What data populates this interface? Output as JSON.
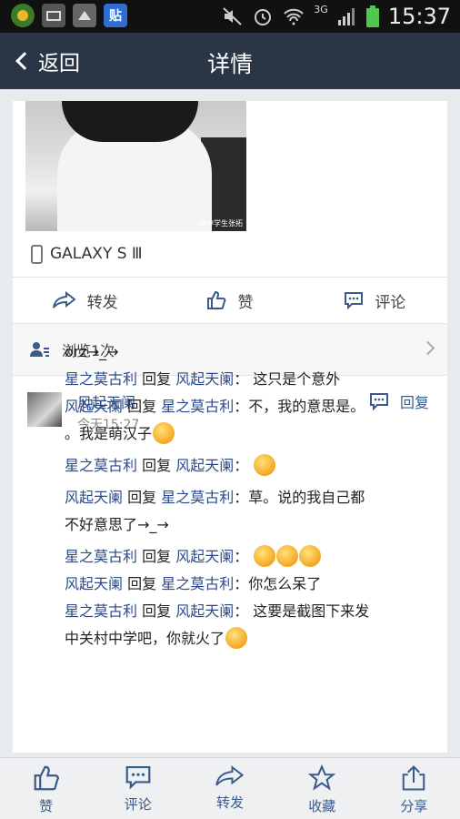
{
  "status_bar": {
    "time": "15:37",
    "network": "3G",
    "left_icons": [
      "app-icon-a",
      "picture-icon",
      "gallery-icon",
      "tieba-icon"
    ],
    "tieba_glyph": "贴",
    "right_icons": [
      "mute-icon",
      "alarm-icon",
      "wifi-icon",
      "signal-icon",
      "battery-icon"
    ]
  },
  "title_bar": {
    "back_label": "返回",
    "title": "详情"
  },
  "post": {
    "photo_watermark": "@中学生张拓",
    "device": "GALAXY S Ⅲ",
    "actions": {
      "repost": "转发",
      "like": "赞",
      "comment": "评论"
    },
    "views": "浏览1次"
  },
  "comment": {
    "author": "风起天阑",
    "time": "今天15:27",
    "reply_label": "回复",
    "lines": {
      "l1": "orz→_→",
      "l2_user": "星之莫古利",
      "l2_verb": " 回复 ",
      "l2_target": "风起天阑",
      "l2_text": "：  这只是个意外",
      "l3_user": "风起天阑",
      "l3_verb": " 回复 ",
      "l3_target": "星之莫古利",
      "l3_text": "：不，我的意思是。",
      "l4_text": "。我是萌汉子",
      "l5_user": "星之莫古利",
      "l5_verb": " 回复 ",
      "l5_target": "风起天阑",
      "l5_text": "：  ",
      "l6_user": "风起天阑",
      "l6_verb": " 回复 ",
      "l6_target": "星之莫古利",
      "l6_text": "：草。说的我自己都",
      "l7_text": "不好意思了→_→",
      "l8_user": "星之莫古利",
      "l8_verb": " 回复 ",
      "l8_target": "风起天阑",
      "l8_text": "：  ",
      "l9_user": "风起天阑",
      "l9_verb": " 回复 ",
      "l9_target": "星之莫古利",
      "l9_text": "：你怎么呆了",
      "l10_user": "星之莫古利",
      "l10_verb": " 回复 ",
      "l10_target": "风起天阑",
      "l10_text": "：  这要是截图下来发",
      "l11_text": "中关村中学吧，你就火了"
    }
  },
  "bottom_bar": {
    "like": "赞",
    "comment": "评论",
    "repost": "转发",
    "favorite": "收藏",
    "share": "分享"
  },
  "colors": {
    "title_bar_bg": "#2a3546",
    "username": "#2a4a8a",
    "accent": "#3a5a8a"
  }
}
